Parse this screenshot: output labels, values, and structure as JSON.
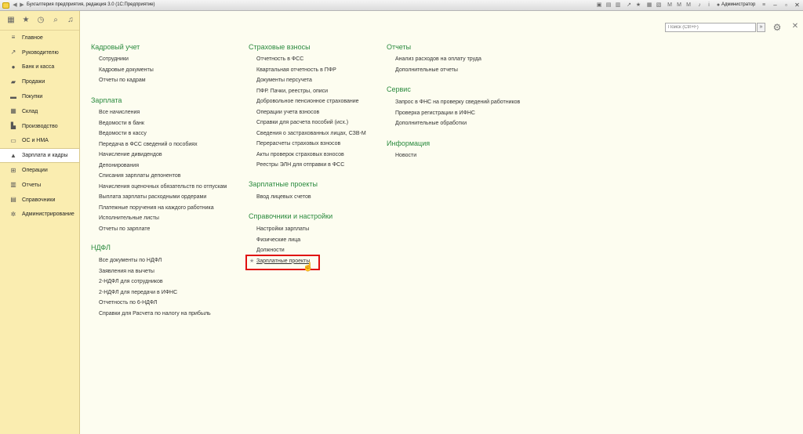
{
  "window": {
    "title": "Бухгалтерия предприятия, редакция 3.0  (1С:Предприятие)",
    "user": "Администратор"
  },
  "search": {
    "placeholder": "Поиск (Ctrl+F)"
  },
  "sidebar": {
    "items": [
      {
        "label": "Главное",
        "icon": "menu-icon",
        "glyph": "≡"
      },
      {
        "label": "Руководителю",
        "icon": "chart-line-icon",
        "glyph": "↗"
      },
      {
        "label": "Банк и касса",
        "icon": "coins-icon",
        "glyph": "●"
      },
      {
        "label": "Продажи",
        "icon": "shopping-bag-icon",
        "glyph": "▰"
      },
      {
        "label": "Покупки",
        "icon": "cart-icon",
        "glyph": "▬"
      },
      {
        "label": "Склад",
        "icon": "warehouse-icon",
        "glyph": "▦"
      },
      {
        "label": "Производство",
        "icon": "factory-icon",
        "glyph": "▙"
      },
      {
        "label": "ОС и НМА",
        "icon": "truck-icon",
        "glyph": "▭"
      },
      {
        "label": "Зарплата и кадры",
        "icon": "person-icon",
        "glyph": "▲"
      },
      {
        "label": "Операции",
        "icon": "operations-icon",
        "glyph": "⊞"
      },
      {
        "label": "Отчеты",
        "icon": "reports-icon",
        "glyph": "▥"
      },
      {
        "label": "Справочники",
        "icon": "books-icon",
        "glyph": "▤"
      },
      {
        "label": "Администрирование",
        "icon": "gear-icon",
        "glyph": "✲"
      }
    ]
  },
  "sections": {
    "kadrovy": {
      "title": "Кадровый учет",
      "links": [
        "Сотрудники",
        "Кадровые документы",
        "Отчеты по кадрам"
      ]
    },
    "zarplata": {
      "title": "Зарплата",
      "links": [
        "Все начисления",
        "Ведомости в банк",
        "Ведомости в кассу",
        "Передача в ФСС сведений о пособиях",
        "Начисление дивидендов",
        "Депонирования",
        "Списания зарплаты депонентов",
        "Начисления оценочных обязательств по отпускам",
        "Выплата зарплаты расходными ордерами",
        "Платежные поручения на каждого работника",
        "Исполнительные листы",
        "Отчеты по зарплате"
      ]
    },
    "ndfl": {
      "title": "НДФЛ",
      "links": [
        "Все документы по НДФЛ",
        "Заявления на вычеты",
        "2-НДФЛ для сотрудников",
        "2-НДФЛ для передачи в ИФНС",
        "Отчетность по 6-НДФЛ",
        "Справки для Расчета по налогу на прибыль"
      ]
    },
    "strahovye": {
      "title": "Страховые взносы",
      "links": [
        "Отчетность в ФСС",
        "Квартальная отчетность в ПФР",
        "Документы персучета",
        "ПФР. Пачки, реестры, описи",
        "Добровольное пенсионное страхование",
        "Операции учета взносов",
        "Справки для расчета пособий (исх.)",
        "Сведения о застрахованных лицах, СЗВ-М",
        "Перерасчеты страховых взносов",
        "Акты проверок страховых взносов",
        "Реестры ЭЛН для отправки в ФСС"
      ]
    },
    "zp_proekty": {
      "title": "Зарплатные проекты",
      "links": [
        "Ввод лицевых счетов"
      ]
    },
    "spravochniki": {
      "title": "Справочники и настройки",
      "links": [
        "Настройки зарплаты",
        "Физические лица",
        "Должности",
        "Зарплатные проекты"
      ]
    },
    "otchety": {
      "title": "Отчеты",
      "links": [
        "Анализ расходов на оплату труда",
        "Дополнительные отчеты"
      ]
    },
    "servis": {
      "title": "Сервис",
      "links": [
        "Запрос в ФНС на проверку сведений работников",
        "Проверка регистрации в ИФНС",
        "Дополнительные обработки"
      ]
    },
    "informaciya": {
      "title": "Информация",
      "links": [
        "Новости"
      ]
    }
  }
}
